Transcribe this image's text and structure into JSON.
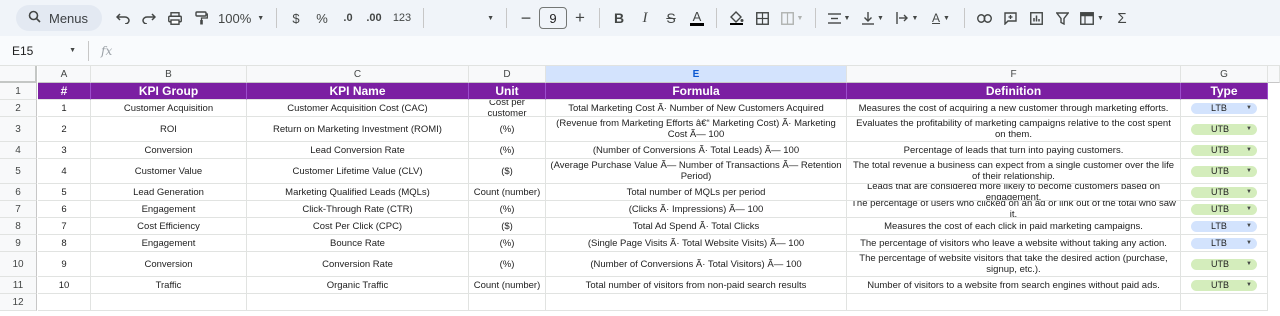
{
  "toolbar": {
    "menus_label": "Menus",
    "zoom": "100%",
    "currency": "$",
    "percent": "%",
    "dec_decrease": ".0",
    "dec_increase": ".00",
    "number_format": "123",
    "font_size": "9",
    "bold": "B",
    "italic": "I",
    "strike": "S",
    "text_color": "A"
  },
  "formula_bar": {
    "cell_ref": "E15",
    "fx": "fx",
    "value": ""
  },
  "colors": {
    "header_bg": "#7b1fa2",
    "utb_chip": "#d4edbc",
    "ltb_chip": "#d3e3fd",
    "selected_col": "#d3e3fd"
  },
  "columns": [
    "A",
    "B",
    "C",
    "D",
    "E",
    "F",
    "G"
  ],
  "rows": [
    "1",
    "2",
    "3",
    "4",
    "5",
    "6",
    "7",
    "8",
    "9",
    "10",
    "11",
    "12"
  ],
  "table": {
    "headers": [
      "#",
      "KPI Group",
      "KPI Name",
      "Unit",
      "Formula",
      "Definition",
      "Type"
    ],
    "rows": [
      {
        "num": "1",
        "group": "Customer Acquisition",
        "name": "Customer Acquisition Cost (CAC)",
        "unit": "Cost per customer",
        "formula": "Total Marketing Cost Ã· Number of New Customers Acquired",
        "definition": "Measures the cost of acquiring a new customer through marketing efforts.",
        "type": "LTB"
      },
      {
        "num": "2",
        "group": "ROI",
        "name": "Return on Marketing Investment (ROMI)",
        "unit": "(%)",
        "formula": "(Revenue from Marketing Efforts â€“ Marketing Cost) Ã· Marketing Cost Ã— 100",
        "definition": "Evaluates the profitability of marketing campaigns relative to the cost spent on them.",
        "type": "UTB"
      },
      {
        "num": "3",
        "group": "Conversion",
        "name": "Lead Conversion Rate",
        "unit": "(%)",
        "formula": "(Number of Conversions Ã· Total Leads) Ã— 100",
        "definition": "Percentage of leads that turn into paying customers.",
        "type": "UTB"
      },
      {
        "num": "4",
        "group": "Customer Value",
        "name": "Customer Lifetime Value (CLV)",
        "unit": "($)",
        "formula": "(Average Purchase Value Ã— Number of Transactions Ã— Retention Period)",
        "definition": "The total revenue a business can expect from a single customer over the life of their relationship.",
        "type": "UTB"
      },
      {
        "num": "5",
        "group": "Lead Generation",
        "name": "Marketing Qualified Leads (MQLs)",
        "unit": "Count (number)",
        "formula": "Total number of MQLs per period",
        "definition": "Leads that are considered more likely to become customers based on engagement.",
        "type": "UTB"
      },
      {
        "num": "6",
        "group": "Engagement",
        "name": "Click-Through Rate (CTR)",
        "unit": "(%)",
        "formula": "(Clicks Ã· Impressions) Ã— 100",
        "definition": "The percentage of users who clicked on an ad or link out of the total who saw it.",
        "type": "UTB"
      },
      {
        "num": "7",
        "group": "Cost Efficiency",
        "name": "Cost Per Click (CPC)",
        "unit": "($)",
        "formula": "Total Ad Spend Ã· Total Clicks",
        "definition": "Measures the cost of each click in paid marketing campaigns.",
        "type": "LTB"
      },
      {
        "num": "8",
        "group": "Engagement",
        "name": "Bounce Rate",
        "unit": "(%)",
        "formula": "(Single Page Visits Ã· Total Website Visits) Ã— 100",
        "definition": "The percentage of visitors who leave a website without taking any action.",
        "type": "LTB"
      },
      {
        "num": "9",
        "group": "Conversion",
        "name": "Conversion Rate",
        "unit": "(%)",
        "formula": "(Number of Conversions Ã· Total Visitors) Ã— 100",
        "definition": "The percentage of website visitors that take the desired action (purchase, signup, etc.).",
        "type": "UTB"
      },
      {
        "num": "10",
        "group": "Traffic",
        "name": "Organic Traffic",
        "unit": "Count (number)",
        "formula": "Total number of visitors from non-paid search results",
        "definition": "Number of visitors to a website from search engines without paid ads.",
        "type": "UTB"
      }
    ]
  }
}
